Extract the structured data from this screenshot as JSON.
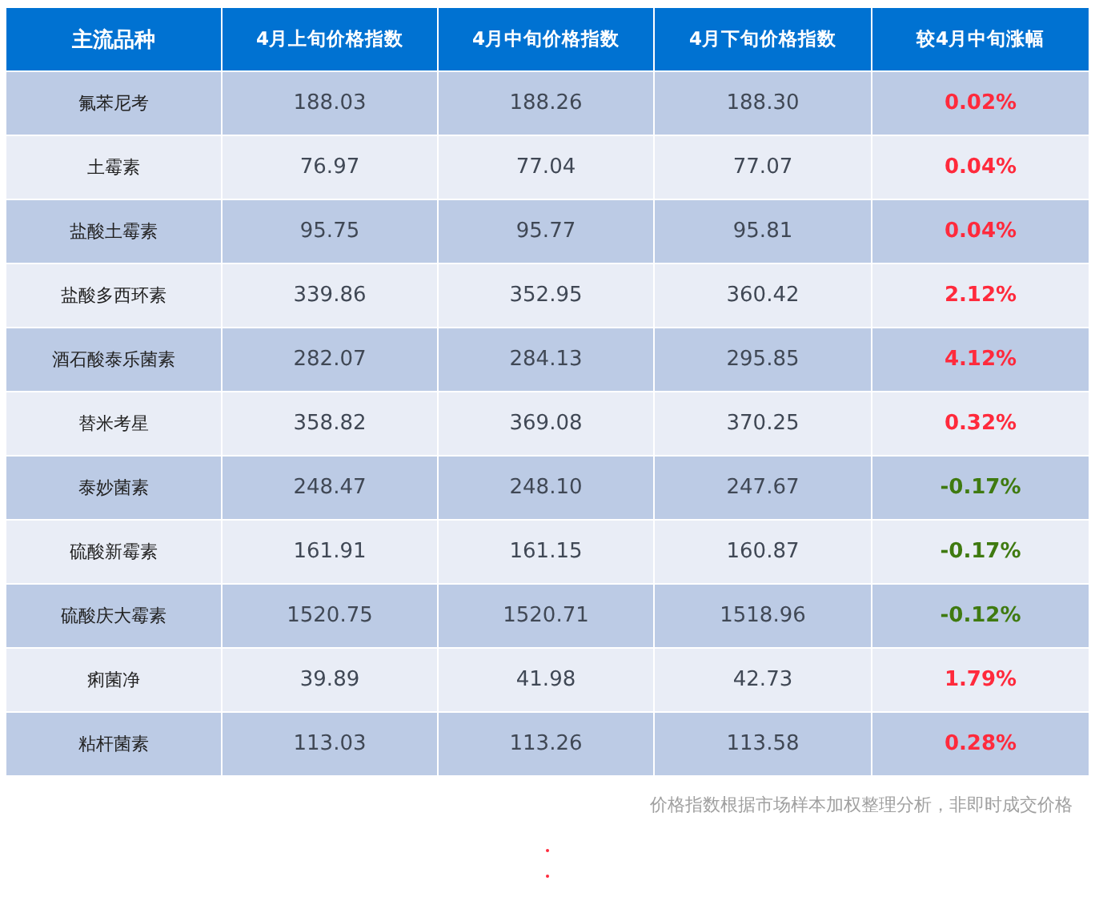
{
  "table": {
    "columns": [
      "主流品种",
      "4月上旬价格指数",
      "4月中旬价格指数",
      "4月下旬价格指数",
      "较4月中旬涨幅"
    ],
    "rows": [
      {
        "name": "氟苯尼考",
        "early": "188.03",
        "mid": "188.26",
        "late": "188.30",
        "change": "0.02%",
        "color": "#ff2a3c"
      },
      {
        "name": "土霉素",
        "early": "76.97",
        "mid": "77.04",
        "late": "77.07",
        "change": "0.04%",
        "color": "#ff2a3c"
      },
      {
        "name": "盐酸土霉素",
        "early": "95.75",
        "mid": "95.77",
        "late": "95.81",
        "change": "0.04%",
        "color": "#ff2a3c"
      },
      {
        "name": "盐酸多西环素",
        "early": "339.86",
        "mid": "352.95",
        "late": "360.42",
        "change": "2.12%",
        "color": "#ff2a3c"
      },
      {
        "name": "酒石酸泰乐菌素",
        "early": "282.07",
        "mid": "284.13",
        "late": "295.85",
        "change": "4.12%",
        "color": "#ff2a3c"
      },
      {
        "name": "替米考星",
        "early": "358.82",
        "mid": "369.08",
        "late": "370.25",
        "change": "0.32%",
        "color": "#ff2a3c"
      },
      {
        "name": "泰妙菌素",
        "early": "248.47",
        "mid": "248.10",
        "late": "247.67",
        "change": "-0.17%",
        "color": "#3f7a10"
      },
      {
        "name": "硫酸新霉素",
        "early": "161.91",
        "mid": "161.15",
        "late": "160.87",
        "change": "-0.17%",
        "color": "#3f7a10"
      },
      {
        "name": "硫酸庆大霉素",
        "early": "1520.75",
        "mid": "1520.71",
        "late": "1518.96",
        "change": "-0.12%",
        "color": "#3f7a10"
      },
      {
        "name": "痢菌净",
        "early": "39.89",
        "mid": "41.98",
        "late": "42.73",
        "change": "1.79%",
        "color": "#ff2a3c"
      },
      {
        "name": "粘杆菌素",
        "early": "113.03",
        "mid": "113.26",
        "late": "113.58",
        "change": "0.28%",
        "color": "#ff2a3c"
      }
    ]
  },
  "footnote": "价格指数根据市场样本加权整理分析，非即时成交价格"
}
